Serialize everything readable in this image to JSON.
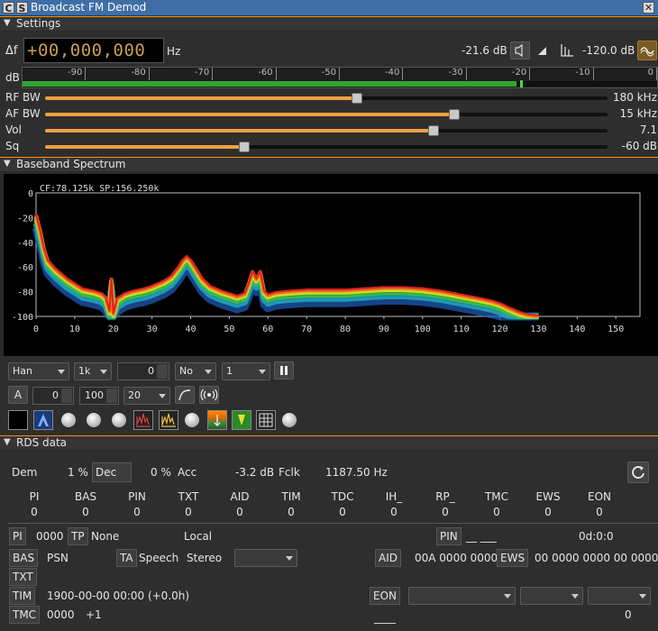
{
  "window": {
    "title": "Broadcast FM Demod",
    "btn_c": "C",
    "btn_s": "S",
    "close": "✕"
  },
  "sections": {
    "settings": "Settings",
    "spectrum": "Baseband Spectrum",
    "rds": "RDS data"
  },
  "settings": {
    "delta_f_label": "Δf",
    "freq_digits": "+00,000,000",
    "freq_unit": "Hz",
    "power_readout": "-21.6  dB",
    "squelch_readout": "-120.0 dB",
    "meter_label": "dB",
    "meter_ticks": [
      "-90",
      "-80",
      "-70",
      "-60",
      "-50",
      "-40",
      "-30",
      "-20",
      "-10",
      "0"
    ],
    "meter_level": -21.6,
    "sliders": [
      {
        "label": "RF BW",
        "value": "180 kHz",
        "fraction": 0.555
      },
      {
        "label": "AF BW",
        "value": "15 kHz",
        "fraction": 0.728
      },
      {
        "label": "Vol",
        "value": "7.1",
        "fraction": 0.69
      },
      {
        "label": "Sq",
        "value": "-60 dB",
        "fraction": 0.354
      }
    ]
  },
  "spectrum": {
    "info": "CF:78.125k SP:156.250k",
    "window_fn": "Han",
    "fft_size": "1k",
    "ref": "0",
    "avg_mode": "No",
    "avg_count": "1",
    "a_btn": "A",
    "spin_offset": "0",
    "spin_range": "100",
    "combo_db": "20"
  },
  "chart_data": {
    "type": "area",
    "title": "",
    "x_ticks": [
      "0",
      "10",
      "20",
      "30",
      "40",
      "50",
      "60",
      "70",
      "80",
      "90",
      "100",
      "110",
      "120",
      "130",
      "140",
      "150"
    ],
    "y_ticks": [
      "0",
      "-20",
      "-40",
      "-60",
      "-80",
      "-100"
    ],
    "xlim": [
      0,
      156.25
    ],
    "ylim": [
      -100,
      0
    ],
    "series": [
      {
        "x": [
          0,
          1,
          2,
          3,
          5,
          8,
          10,
          12,
          15,
          17,
          18,
          19,
          19.5,
          20,
          21,
          23,
          25,
          28,
          30,
          33,
          35,
          37,
          38,
          39,
          40,
          41,
          43,
          45,
          48,
          50,
          52,
          54,
          55,
          56,
          57,
          58,
          59,
          60,
          62,
          65,
          70,
          75,
          80,
          85,
          90,
          95,
          100,
          105,
          110,
          115,
          118,
          120,
          122,
          125,
          127,
          130
        ],
        "y": [
          -18,
          -30,
          -45,
          -55,
          -62,
          -70,
          -74,
          -78,
          -80,
          -82,
          -85,
          -96,
          -70,
          -98,
          -86,
          -82,
          -80,
          -78,
          -76,
          -72,
          -68,
          -60,
          -55,
          -52,
          -55,
          -60,
          -70,
          -76,
          -80,
          -82,
          -84,
          -82,
          -74,
          -64,
          -70,
          -64,
          -80,
          -83,
          -81,
          -80,
          -79,
          -79,
          -79,
          -78,
          -77,
          -77,
          -78,
          -80,
          -83,
          -86,
          -88,
          -90,
          -93,
          -97,
          -99,
          -100
        ]
      }
    ]
  },
  "rds": {
    "dem_label": "Dem",
    "dem_value": "1 %",
    "dec_label": "Dec",
    "dec_value": "0 %",
    "acc_label": "Acc",
    "acc_value": "-3.2 dB",
    "fclk_label": "Fclk",
    "fclk_value": "1187.50 Hz",
    "counters": [
      {
        "name": "PI",
        "value": "0"
      },
      {
        "name": "BAS",
        "value": "0"
      },
      {
        "name": "PIN",
        "value": "0"
      },
      {
        "name": "TXT",
        "value": "0"
      },
      {
        "name": "AID",
        "value": "0"
      },
      {
        "name": "TIM",
        "value": "0"
      },
      {
        "name": "TDC",
        "value": "0"
      },
      {
        "name": "IH_",
        "value": "0"
      },
      {
        "name": "RP_",
        "value": "0"
      },
      {
        "name": "TMC",
        "value": "0"
      },
      {
        "name": "EWS",
        "value": "0"
      },
      {
        "name": "EON",
        "value": "0"
      }
    ],
    "pi_label": "PI",
    "pi_value": "0000",
    "tp_label": "TP",
    "tp_value": "None",
    "local": "Local",
    "pin_label": "PIN",
    "pin_value": "__ ___",
    "pin_time": "0d:0:0",
    "bas_label": "BAS",
    "psn": "PSN",
    "ta_label": "TA",
    "speech": "Speech",
    "stereo": "Stereo",
    "aid_label": "AID",
    "aid_value": "00A 0000 0000",
    "ews_label": "EWS",
    "ews_value": "00 0000 0000 00 0000",
    "txt_label": "TXT",
    "tim_label": "TIM",
    "tim_value": "1900-00-00 00:00 (+0.0h)",
    "eon_label": "EON",
    "tmc_label": "TMC",
    "tmc_value": "0000",
    "tmc_offset": "+1",
    "bottom_line": "____",
    "bottom_zero": "0"
  },
  "colors": {
    "accent": "#ff8c00",
    "slider": "#f0a040",
    "meter": "#2fa52f",
    "title_bar": "#3f6ea6"
  }
}
